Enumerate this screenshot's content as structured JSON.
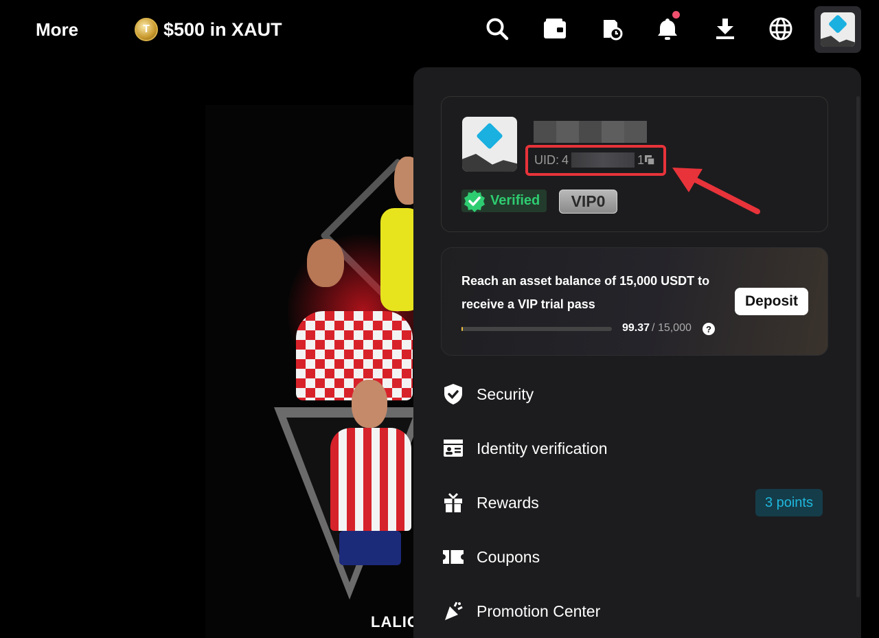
{
  "topbar": {
    "more_label": "More",
    "promo_text": "$500 in XAUT",
    "coin_letter": "T",
    "icons": [
      "search-icon",
      "wallet-icon",
      "history-icon",
      "bell-icon",
      "download-icon",
      "globe-icon"
    ]
  },
  "banner": {
    "brand_text": "LALIG"
  },
  "profile": {
    "uid_label": "UID:",
    "uid_prefix": "4",
    "uid_suffix": "1",
    "verified_label": "Verified",
    "vip_level": "VIP0"
  },
  "vip_promo": {
    "message": "Reach an asset balance of 15,000 USDT to receive a VIP trial pass",
    "deposit_label": "Deposit",
    "current": "99.37",
    "target": "/ 15,000",
    "progress_fraction": 0.0066,
    "help_symbol": "?"
  },
  "menu": {
    "items": [
      {
        "label": "Security"
      },
      {
        "label": "Identity verification"
      },
      {
        "label": "Rewards",
        "badge": "3 points"
      },
      {
        "label": "Coupons"
      },
      {
        "label": "Promotion Center"
      }
    ]
  },
  "colors": {
    "accent_blue": "#1ab0e0",
    "verified_green": "#2ecc71",
    "highlight_red": "#e8333a",
    "notification": "#f0506e"
  }
}
